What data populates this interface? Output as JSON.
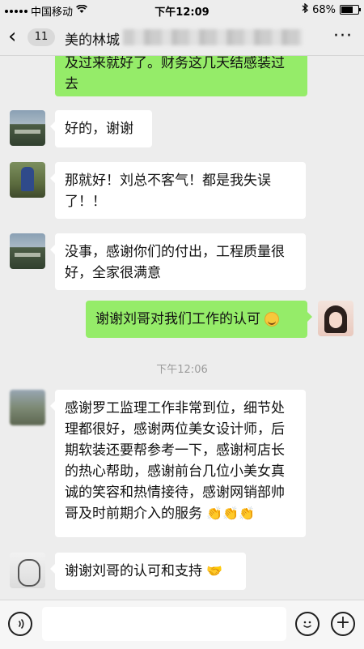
{
  "status_bar": {
    "carrier": "中国移动",
    "time": "下午12:09",
    "battery": "68%",
    "battery_level": 0.68
  },
  "nav": {
    "unread_count": "11",
    "title": "美的林城"
  },
  "messages": [
    {
      "side": "out",
      "text": "及过来就好了。财务这几天结感装过去"
    },
    {
      "side": "in",
      "text": "好的，谢谢"
    },
    {
      "side": "in",
      "text": "那就好！刘总不客气！都是我失误了！！"
    },
    {
      "side": "in",
      "text": "没事，感谢你们的付出，工程质量很好，全家很满意"
    },
    {
      "side": "out",
      "text": "谢谢刘哥对我们工作的认可",
      "emoji": "smile-emoji"
    }
  ],
  "timestamp": "下午12:06",
  "messages_after": [
    {
      "side": "in",
      "text": "感谢罗工监理工作非常到位，细节处理都很好，感谢两位美女设计师，后期软装还要帮参考一下，感谢柯店长的热心帮助，感谢前台几位小美女真诚的笑容和热情接待，感谢网销部帅哥及时前期介入的服务",
      "emoji": "clap-emoji"
    },
    {
      "side": "in",
      "text": "谢谢刘哥的认可和支持",
      "emoji": "handshake-emoji"
    }
  ],
  "emoji_glyphs": {
    "clap": "👏👏👏",
    "handshake": "🤝"
  },
  "colors": {
    "outgoing_bubble": "#95ec69",
    "incoming_bubble": "#ffffff",
    "background": "#ededed"
  }
}
